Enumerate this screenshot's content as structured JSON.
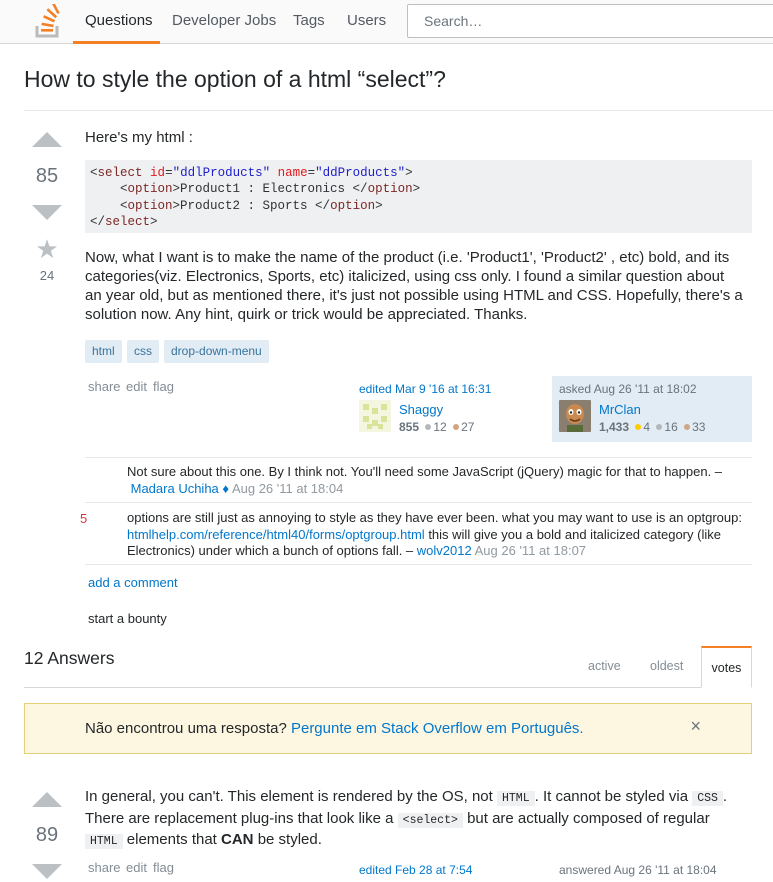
{
  "nav": {
    "questions": "Questions",
    "jobs": "Developer Jobs",
    "tags": "Tags",
    "users": "Users",
    "search_placeholder": "Search…"
  },
  "question": {
    "title": "How to style the option of a html “select”?",
    "votes": "85",
    "favorites": "24",
    "intro": "Here's my html :",
    "code_lines": [
      [
        "<",
        "select",
        " ",
        "id",
        "=",
        "\"ddlProducts\"",
        " ",
        "name",
        "=",
        "\"ddProducts\"",
        ">"
      ],
      [
        "    <",
        "option",
        ">Product1 : Electronics </",
        "option",
        ">"
      ],
      [
        "    <",
        "option",
        ">Product2 : Sports </",
        "option",
        ">"
      ],
      [
        "</",
        "select",
        ">"
      ]
    ],
    "body": "Now, what I want is to make the name of the product (i.e. 'Product1', 'Product2' , etc) bold, and its categories(viz. Electronics, Sports, etc) italicized, using css only. I found a similar question about an year old, but as mentioned there, it's just not possible using HTML and CSS. Hopefully, there's a solution now. Any hint, quirk or trick would be appreciated. Thanks.",
    "tags": [
      "html",
      "css",
      "drop-down-menu"
    ],
    "menu": {
      "share": "share",
      "edit": "edit",
      "flag": "flag"
    },
    "editor": {
      "action": "edited Mar 9 '16 at 16:31",
      "name": "Shaggy",
      "rep": "855",
      "silver": "12",
      "bronze": "27"
    },
    "owner": {
      "action": "asked Aug 26 '11 at 18:02",
      "name": "MrClan",
      "rep": "1,433",
      "gold": "4",
      "silver": "16",
      "bronze": "33"
    }
  },
  "comments": [
    {
      "score": "",
      "text": "Not sure about this one. By I think not. You'll need some JavaScript (jQuery) magic for that to happen. –",
      "user": "Madara Uchiha",
      "mod": "♦",
      "time": "Aug 26 '11 at 18:04"
    },
    {
      "score": "5",
      "text_a": "options are still just as annoying to style as they have ever been. what you may want to use is an optgroup:",
      "link": "htmlhelp.com/reference/html40/forms/optgroup.html",
      "text_b": "this will give you a bold and italicized category (like Electronics) under which a bunch of options fall. –",
      "user": "wolv2012",
      "time": "Aug 26 '11 at 18:07"
    }
  ],
  "add_comment": "add a comment",
  "start_bounty": "start a bounty",
  "answers": {
    "heading": "12 Answers",
    "tabs": {
      "active": "active",
      "oldest": "oldest",
      "votes": "votes"
    }
  },
  "notice": {
    "text": "Não encontrou uma resposta?",
    "link": "Pergunte em Stack Overflow em Português.",
    "close": "×"
  },
  "answer": {
    "votes": "89",
    "p1": "In general, you can't. This element is rendered by the OS, not",
    "c1": "HTML",
    "p2": ". It cannot be styled via",
    "c2": "CSS",
    "p3": ".",
    "p4": "There are replacement plug-ins that look like a",
    "c3": "<select>",
    "p5": "but are actually composed of regular",
    "c4": "HTML",
    "p6": "elements that",
    "strong": "CAN",
    "p7": "be styled.",
    "menu": {
      "share": "share",
      "edit": "edit",
      "flag": "flag"
    },
    "edited": "edited Feb 28 at 7:54",
    "answered": "answered Aug 26 '11 at 18:04"
  },
  "colors": {
    "accent": "#f48024",
    "link": "#0077cc",
    "tag_bg": "#e1ecf4",
    "notice_bg": "#fdf7e2"
  }
}
